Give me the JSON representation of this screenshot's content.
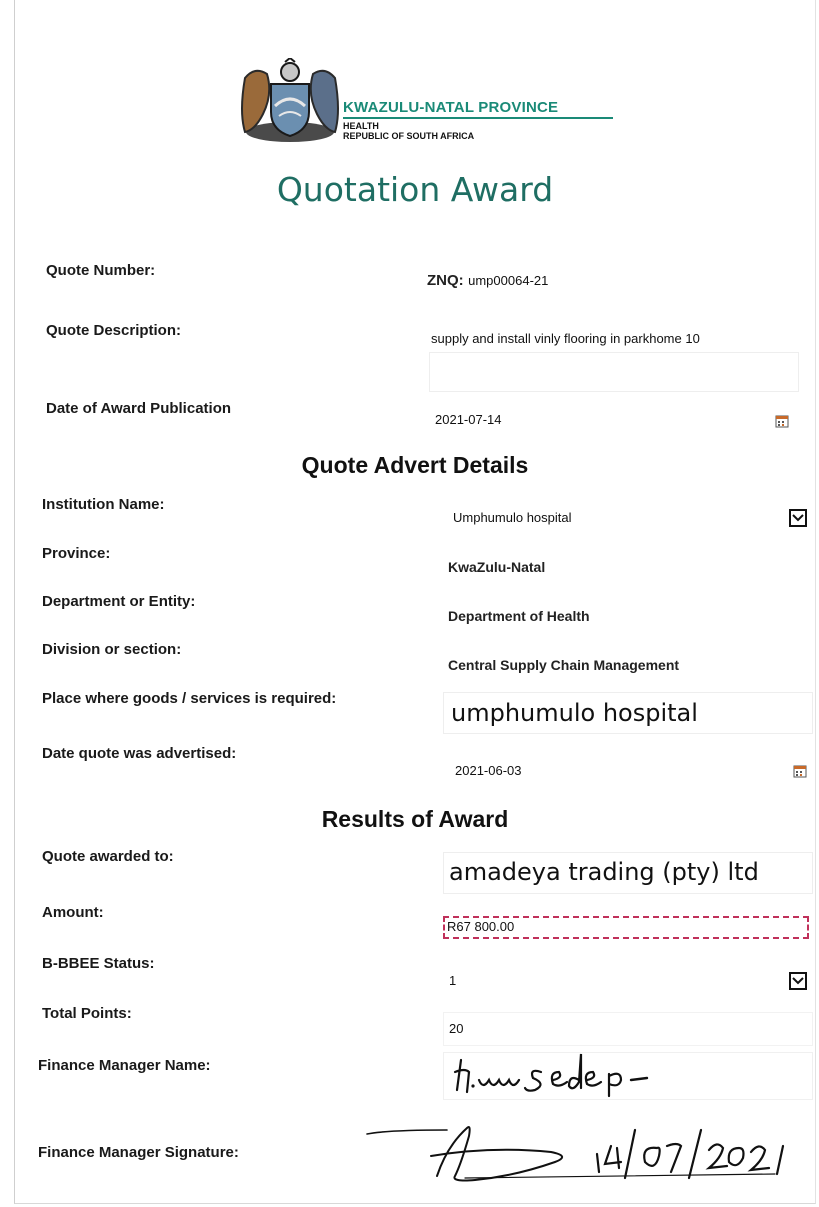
{
  "header": {
    "province": "KWAZULU-NATAL PROVINCE",
    "department": "HEALTH",
    "country": "REPUBLIC OF SOUTH AFRICA",
    "title": "Quotation Award"
  },
  "quote": {
    "number_label": "Quote Number:",
    "number_prefix": "ZNQ:",
    "number_value": "ump00064-21",
    "description_label": "Quote Description:",
    "description_value": "supply and install vinly flooring in parkhome 10",
    "award_date_label": "Date of Award Publication",
    "award_date_value": "2021-07-14"
  },
  "advert": {
    "heading": "Quote Advert Details",
    "institution_label": "Institution Name:",
    "institution_value": "Umphumulo hospital",
    "province_label": "Province:",
    "province_value": "KwaZulu-Natal",
    "department_label": "Department or Entity:",
    "department_value": "Department of Health",
    "division_label": "Division or section:",
    "division_value": "Central Supply Chain Management",
    "place_label": "Place where goods /  services is required:",
    "place_value": "umphumulo hospital",
    "advertised_label": "Date quote was advertised:",
    "advertised_value": "2021-06-03"
  },
  "results": {
    "heading": "Results of Award",
    "awarded_label": "Quote awarded to:",
    "awarded_value": "amadeya trading (pty) ltd",
    "amount_label": "Amount:",
    "amount_value": "R67 800.00",
    "bbbee_label": "B-BBEE Status:",
    "bbbee_value": "1",
    "points_label": "Total Points:",
    "points_value": "20",
    "manager_name_label": "Finance Manager Name:",
    "manager_name_value": "Humsedep",
    "manager_sig_label": "Finance Manager Signature:",
    "manager_sig_date": "14/07/2021"
  },
  "colors": {
    "title": "#1f6e63",
    "brand": "#1a8a77",
    "amount_border": "#c0305a",
    "ink": "#111111"
  }
}
